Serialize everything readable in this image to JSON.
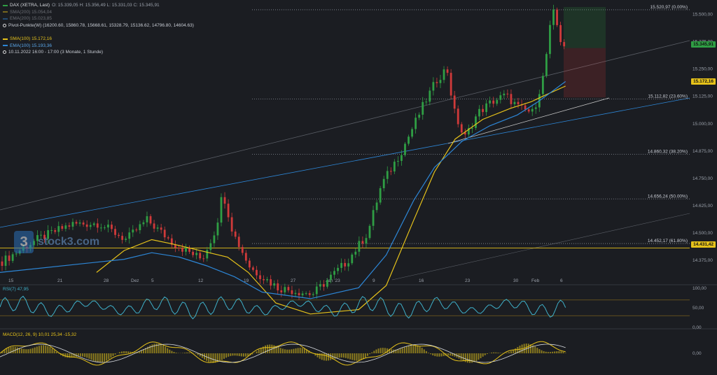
{
  "legend": {
    "instrument": "DAX (XETRA, Last)",
    "ohlc": "O: 15.339,05  H: 15.356,49  L: 15.331,03  C: 15.345,91",
    "sma200": "SMA(200)  15.054,04",
    "ema200": "EMA(200)  15.023,85",
    "pivot": "Pivot-Punkte(W)  (16200.60, 15860.78, 15668.61, 15328.79, 15136.62, 14796.80, 14604.63)",
    "sma100": "SMA(100)  15.172,16",
    "ema100": "EMA(100)  15.193,36",
    "range": "10.11.2022 16:00 - 17:00  (3 Monate, 1 Stunde)"
  },
  "logo": {
    "badge": "3",
    "text": "stock3.com"
  },
  "colors": {
    "up": "#2f9e44",
    "down": "#d03a3a",
    "sma": "#e6c21a",
    "ema": "#2d86d6",
    "fib": "#8a8f99",
    "bg": "#1b1d22"
  },
  "price_labels": {
    "last": "15.345,91",
    "sma100": "15.172,16",
    "support": "14.431,42"
  },
  "rsi_legend": "RSI(7)  47,95",
  "macd_legend": "MACD(12, 26, 9)  10,01  25,34  -15,32",
  "chart_data": {
    "type": "candlestick",
    "main": {
      "y_ticks": [
        15500,
        15375,
        15250,
        15125,
        15000,
        14875,
        14750,
        14625,
        14500,
        14375
      ],
      "y_tick_labels": [
        "15.500,00",
        "15.375,00",
        "15.250,00",
        "15.125,00",
        "15.000,00",
        "14.875,00",
        "14.750,00",
        "14.625,00",
        "14.500,00",
        "14.375,00"
      ],
      "ylim": [
        14270,
        15540
      ],
      "fib_levels": [
        {
          "value": 15520.97,
          "label": "15.520,97 (0.00%)"
        },
        {
          "value": 15112.82,
          "label": "15.112,82 (23.60%)"
        },
        {
          "value": 14860.32,
          "label": "14.860,32 (38.20%)"
        },
        {
          "value": 14656.24,
          "label": "14.656,24 (50.00%)"
        },
        {
          "value": 14452.17,
          "label": "14.452,17 (61.80%)"
        }
      ],
      "support_level": 14431.42,
      "last_price": 15345.91,
      "sma100_value": 15172.16
    },
    "x_labels": [
      "15",
      "21",
      "28",
      "Dez",
      "5",
      "12",
      "19",
      "27",
      "Jan '23",
      "9",
      "16",
      "23",
      "30",
      "Feb",
      "6"
    ],
    "price_path": [
      [
        0,
        14370
      ],
      [
        0.05,
        14470
      ],
      [
        0.1,
        14540
      ],
      [
        0.14,
        14545
      ],
      [
        0.18,
        14470
      ],
      [
        0.21,
        14560
      ],
      [
        0.25,
        14450
      ],
      [
        0.29,
        14380
      ],
      [
        0.31,
        14520
      ],
      [
        0.32,
        14690
      ],
      [
        0.335,
        14500
      ],
      [
        0.36,
        14340
      ],
      [
        0.4,
        14250
      ],
      [
        0.45,
        14220
      ],
      [
        0.5,
        14370
      ],
      [
        0.53,
        14500
      ],
      [
        0.55,
        14720
      ],
      [
        0.58,
        14880
      ],
      [
        0.61,
        15080
      ],
      [
        0.63,
        15200
      ],
      [
        0.645,
        15255
      ],
      [
        0.655,
        15060
      ],
      [
        0.67,
        14930
      ],
      [
        0.69,
        15050
      ],
      [
        0.71,
        15100
      ],
      [
        0.73,
        15130
      ],
      [
        0.75,
        15070
      ],
      [
        0.77,
        15050
      ],
      [
        0.785,
        15220
      ],
      [
        0.795,
        15450
      ],
      [
        0.8,
        15510
      ],
      [
        0.81,
        15380
      ],
      [
        0.82,
        15340
      ]
    ],
    "sma100_path": [
      [
        0.14,
        14320
      ],
      [
        0.18,
        14420
      ],
      [
        0.22,
        14470
      ],
      [
        0.25,
        14450
      ],
      [
        0.29,
        14420
      ],
      [
        0.33,
        14390
      ],
      [
        0.36,
        14320
      ],
      [
        0.4,
        14180
      ],
      [
        0.45,
        14130
      ],
      [
        0.52,
        14150
      ],
      [
        0.56,
        14260
      ],
      [
        0.6,
        14560
      ],
      [
        0.63,
        14780
      ],
      [
        0.66,
        14930
      ],
      [
        0.7,
        15020
      ],
      [
        0.74,
        15070
      ],
      [
        0.77,
        15100
      ],
      [
        0.79,
        15130
      ],
      [
        0.82,
        15172
      ]
    ],
    "ema100_path": [
      [
        0.0,
        14320
      ],
      [
        0.18,
        14380
      ],
      [
        0.22,
        14410
      ],
      [
        0.26,
        14390
      ],
      [
        0.3,
        14350
      ],
      [
        0.34,
        14300
      ],
      [
        0.38,
        14230
      ],
      [
        0.45,
        14200
      ],
      [
        0.52,
        14250
      ],
      [
        0.56,
        14400
      ],
      [
        0.6,
        14650
      ],
      [
        0.63,
        14800
      ],
      [
        0.67,
        14920
      ],
      [
        0.71,
        14990
      ],
      [
        0.75,
        15040
      ],
      [
        0.78,
        15100
      ],
      [
        0.82,
        15193
      ]
    ],
    "rsi": {
      "value": 47.95,
      "levels": [
        100,
        50,
        0
      ],
      "tick_labels": [
        "100,00",
        "50,00",
        "0,00"
      ]
    },
    "macd": {
      "macd": 10.01,
      "signal": 25.34,
      "histogram": -15.32,
      "tick_labels": [
        "0,00"
      ]
    }
  }
}
